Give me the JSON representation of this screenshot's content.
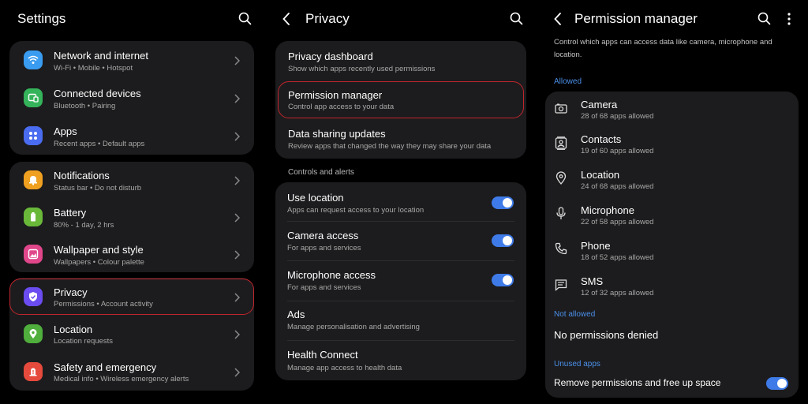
{
  "colors": {
    "accent": "#3e7be8",
    "highlight": "#c0252c",
    "card": "#1c1c1e",
    "section_blue": "#4a8fe8"
  },
  "settings": {
    "title": "Settings",
    "groups": [
      [
        {
          "title": "Network and internet",
          "subtitle": "Wi-Fi  •  Mobile  •  Hotspot",
          "icon": "wifi-icon",
          "color": "#3a9cf0"
        },
        {
          "title": "Connected devices",
          "subtitle": "Bluetooth  •  Pairing",
          "icon": "connected-devices-icon",
          "color": "#34b35a"
        },
        {
          "title": "Apps",
          "subtitle": "Recent apps  •  Default apps",
          "icon": "apps-icon",
          "color": "#4a6cf0"
        }
      ],
      [
        {
          "title": "Notifications",
          "subtitle": "Status bar  •  Do not disturb",
          "icon": "bell-icon",
          "color": "#f0a020"
        },
        {
          "title": "Battery",
          "subtitle": "80% - 1 day, 2 hrs",
          "icon": "battery-icon",
          "color": "#6ab83a"
        },
        {
          "title": "Wallpaper and style",
          "subtitle": "Wallpapers  •  Colour palette",
          "icon": "wallpaper-icon",
          "color": "#e0468a"
        }
      ],
      [
        {
          "title": "Privacy",
          "subtitle": "Permissions  •  Account activity",
          "icon": "shield-icon",
          "color": "#6a4cf0"
        },
        {
          "title": "Location",
          "subtitle": "Location requests",
          "icon": "location-pin-icon",
          "color": "#4fae3c"
        },
        {
          "title": "Safety and emergency",
          "subtitle": "Medical info  •  Wireless emergency alerts",
          "icon": "emergency-icon",
          "color": "#e54a3c"
        }
      ]
    ]
  },
  "privacy": {
    "title": "Privacy",
    "top_items": [
      {
        "title": "Privacy dashboard",
        "subtitle": "Show which apps recently used permissions"
      },
      {
        "title": "Permission manager",
        "subtitle": "Control app access to your data"
      },
      {
        "title": "Data sharing updates",
        "subtitle": "Review apps that changed the way they may share your data"
      }
    ],
    "section_label": "Controls and alerts",
    "controls": [
      {
        "title": "Use location",
        "subtitle": "Apps can request access to your location",
        "toggle": true
      },
      {
        "title": "Camera access",
        "subtitle": "For apps and services",
        "toggle": true
      },
      {
        "title": "Microphone access",
        "subtitle": "For apps and services",
        "toggle": true
      },
      {
        "title": "Ads",
        "subtitle": "Manage personalisation and advertising",
        "toggle": false
      },
      {
        "title": "Health Connect",
        "subtitle": "Manage app access to health data",
        "toggle": false
      }
    ]
  },
  "permission_manager": {
    "title": "Permission manager",
    "description_line1": "Control which apps can access data like camera, microphone and",
    "description_line2": "location.",
    "allowed_label": "Allowed",
    "items": [
      {
        "title": "Camera",
        "subtitle": "28 of 68 apps allowed",
        "icon": "camera-icon"
      },
      {
        "title": "Contacts",
        "subtitle": "19 of 60 apps allowed",
        "icon": "contacts-icon"
      },
      {
        "title": "Location",
        "subtitle": "24 of 68 apps allowed",
        "icon": "location-icon"
      },
      {
        "title": "Microphone",
        "subtitle": "22 of 58 apps allowed",
        "icon": "microphone-icon"
      },
      {
        "title": "Phone",
        "subtitle": "18 of 52 apps allowed",
        "icon": "phone-icon"
      },
      {
        "title": "SMS",
        "subtitle": "12 of 32 apps allowed",
        "icon": "sms-icon"
      }
    ],
    "not_allowed_label": "Not allowed",
    "no_permissions_text": "No permissions denied",
    "unused_label": "Unused apps",
    "unused_toggle_text": "Remove permissions and free up space",
    "unused_toggle_on": true
  }
}
